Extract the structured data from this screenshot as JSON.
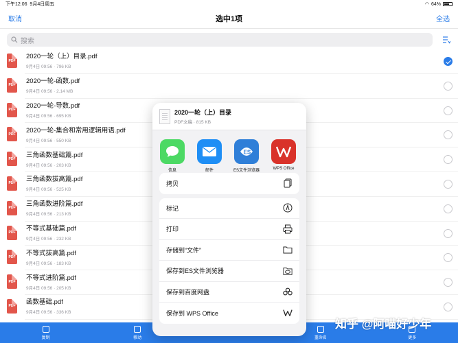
{
  "status": {
    "time": "下午12:06",
    "date": "9月4日周五",
    "battery": "64%"
  },
  "nav": {
    "cancel": "取消",
    "title": "选中1项",
    "select_all": "全选"
  },
  "search": {
    "placeholder": "搜索"
  },
  "pdf_badge": "PDF",
  "files": [
    {
      "name": "2020一轮（上）目录.pdf",
      "meta": "9月4日 09:56  ·  796 KB",
      "selected": true
    },
    {
      "name": "2020一轮-函数.pdf",
      "meta": "9月4日 09:56  ·  2.14 MB",
      "selected": false
    },
    {
      "name": "2020一轮-导数.pdf",
      "meta": "9月4日 09:56  ·  695 KB",
      "selected": false
    },
    {
      "name": "2020一轮-集合和常用逻辑用语.pdf",
      "meta": "9月4日 09:56  ·  550 KB",
      "selected": false
    },
    {
      "name": "三角函数基础篇.pdf",
      "meta": "9月4日 09:56  ·  203 KB",
      "selected": false
    },
    {
      "name": "三角函数拔高篇.pdf",
      "meta": "9月4日 09:56  ·  525 KB",
      "selected": false
    },
    {
      "name": "三角函数进阶篇.pdf",
      "meta": "9月4日 09:56  ·  213 KB",
      "selected": false
    },
    {
      "name": "不等式基础篇.pdf",
      "meta": "9月4日 09:56  ·  232 KB",
      "selected": false
    },
    {
      "name": "不等式拔高篇.pdf",
      "meta": "9月4日 09:56  ·  183 KB",
      "selected": false
    },
    {
      "name": "不等式进阶篇.pdf",
      "meta": "9月4日 09:56  ·  205 KB",
      "selected": false
    },
    {
      "name": "函数基础.pdf",
      "meta": "9月4日 09:56  ·  336 KB",
      "selected": false
    }
  ],
  "toolbar": {
    "copy": "复制",
    "move": "移动",
    "rename": "重命名",
    "more": "更多"
  },
  "share": {
    "file_title": "2020一轮（上）目录",
    "file_sub": "PDF文稿 · 815 KB",
    "apps": [
      {
        "label": "信息",
        "icon": "messages-icon",
        "color": "#4cd964"
      },
      {
        "label": "邮件",
        "icon": "mail-icon",
        "color": "#1e8ef5"
      },
      {
        "label": "ES文件浏览器",
        "icon": "es-icon",
        "color": "#2f7fd8"
      },
      {
        "label": "WPS Office",
        "icon": "wps-icon",
        "color": "#d9322a"
      }
    ],
    "actions_group1": [
      {
        "label": "拷贝",
        "icon": "copy-icon"
      }
    ],
    "actions_group2": [
      {
        "label": "标记",
        "icon": "markup-icon"
      },
      {
        "label": "打印",
        "icon": "print-icon"
      },
      {
        "label": "存储到“文件”",
        "icon": "folder-icon"
      },
      {
        "label": "保存到ES文件浏览器",
        "icon": "es-save-icon"
      },
      {
        "label": "保存到百度网盘",
        "icon": "baidu-icon"
      },
      {
        "label": "保存到 WPS Office",
        "icon": "wps-save-icon"
      }
    ]
  },
  "watermark": "知乎 @阿喵好少年"
}
